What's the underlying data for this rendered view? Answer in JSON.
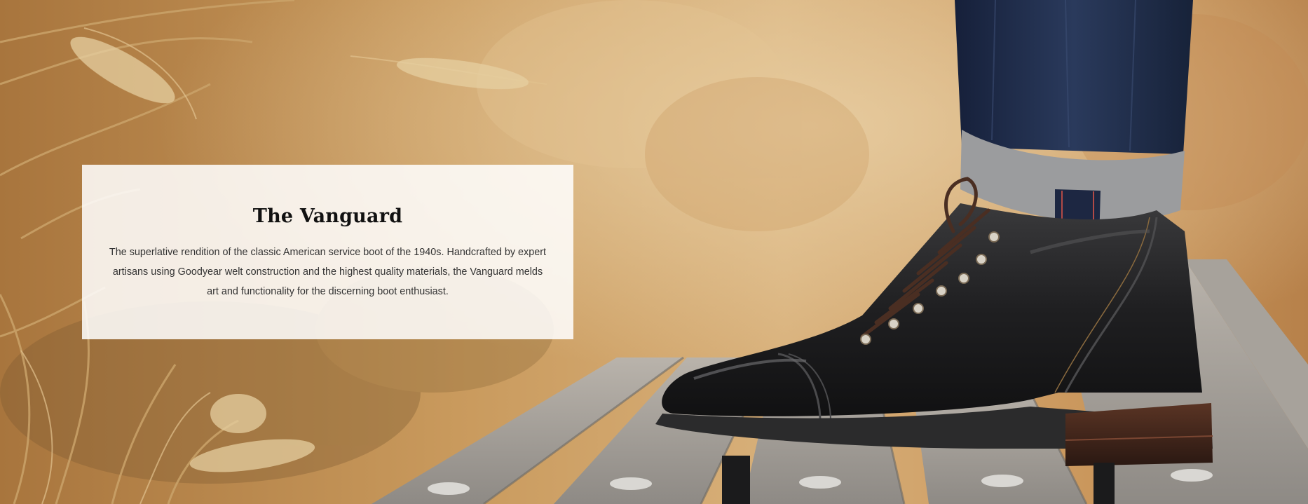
{
  "hero": {
    "image_subject": "black-leather-boot-on-wooden-boardwalk-with-wheat-grass"
  },
  "card": {
    "title": "The Vanguard",
    "description": "The superlative rendition of the classic American service boot of the 1940s. Handcrafted by expert artisans using Goodyear welt construction and the highest quality materials, the Vanguard melds art and functionality for the discerning boot enthusiast."
  },
  "colors": {
    "card_background": "#ffffff",
    "title_color": "#111111",
    "text_color": "#333333",
    "wheat": "#c79a5c",
    "boot_leather": "#1c1c1d",
    "denim": "#1e2a44",
    "wood": "#9a9690"
  }
}
